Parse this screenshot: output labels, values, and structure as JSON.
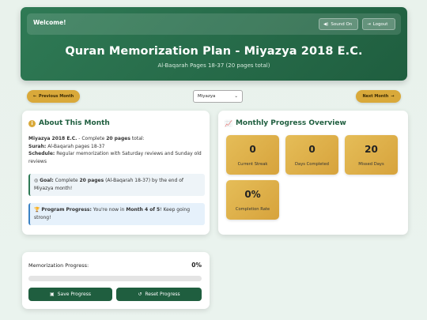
{
  "header": {
    "welcome": "Welcome!",
    "sound_label": "Sound On",
    "logout_label": "Logout",
    "title": "Quran Memorization Plan - Miyazya 2018 E.C.",
    "subtitle": "Al-Baqarah Pages 18-37 (20 pages total)"
  },
  "nav": {
    "prev_label": "Previous Month",
    "next_label": "Next Month",
    "month_selected": "Miyazya"
  },
  "about": {
    "title": "About This Month",
    "line1_bold": "Miyazya 2018 E.C.",
    "line1_text": " - Complete ",
    "line1_pages": "20 pages",
    "line1_tail": " total:",
    "surah_label": "Surah:",
    "surah_text": " Al-Baqarah pages 18-37",
    "schedule_label": "Schedule:",
    "schedule_text": " Regular memorization with Saturday reviews and Sunday old reviews",
    "goal_label": "Goal:",
    "goal_text_a": " Complete ",
    "goal_pages": "20 pages",
    "goal_text_b": " (Al-Baqarah 18-37) by the end of Miyazya month!",
    "program_label": "Program Progress:",
    "program_text_a": " You're now in ",
    "program_month": "Month 4 of 5",
    "program_text_b": "! Keep going strong!"
  },
  "overview": {
    "title": "Monthly Progress Overview",
    "stats": [
      {
        "value": "0",
        "label": "Current Streak"
      },
      {
        "value": "0",
        "label": "Days Completed"
      },
      {
        "value": "20",
        "label": "Missed Days"
      },
      {
        "value": "0%",
        "label": "Completion Rate"
      }
    ]
  },
  "progress": {
    "label": "Memorization Progress:",
    "percent_text": "0%",
    "fraction": 0,
    "save_label": "Save Progress",
    "reset_label": "Reset Progress"
  },
  "icons": {
    "sound": "volume-icon",
    "logout": "logout-icon",
    "info": "info-icon",
    "chart": "chart-icon",
    "save": "save-icon",
    "reset": "reset-icon"
  },
  "colors": {
    "primary": "#1f5e3f",
    "accent": "#d9a93a",
    "background": "#e9f2ec"
  }
}
